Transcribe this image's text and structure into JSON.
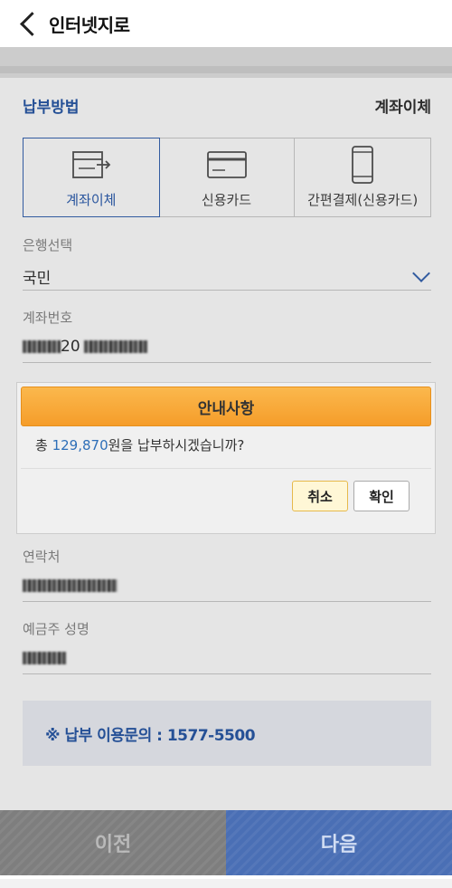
{
  "header": {
    "title": "인터넷지로"
  },
  "payment": {
    "label": "납부방법",
    "selected": "계좌이체",
    "tabs": [
      {
        "label": "계좌이체",
        "icon": "bank-transfer-icon",
        "active": true
      },
      {
        "label": "신용카드",
        "icon": "credit-card-icon",
        "active": false
      },
      {
        "label": "간편결제(신용카드)",
        "icon": "smartphone-icon",
        "active": false
      }
    ]
  },
  "fields": {
    "bank_label": "은행선택",
    "bank_value": "국민",
    "account_label": "계좌번호",
    "account_visible": "20",
    "contact_label": "연락처",
    "holder_label": "예금주 성명"
  },
  "notice": {
    "text": "※ 납부 이용문의 : 1577-5500"
  },
  "modal": {
    "title": "안내사항",
    "msg_prefix": "총 ",
    "amount": "129,870",
    "msg_suffix": "원을 납부하시겠습니까?",
    "cancel": "취소",
    "confirm": "확인"
  },
  "footer": {
    "prev": "이전",
    "next": "다음"
  },
  "colors": {
    "accent": "#3866b3",
    "modal_header": "#f7a834",
    "next_button": "#4a6fb5"
  }
}
